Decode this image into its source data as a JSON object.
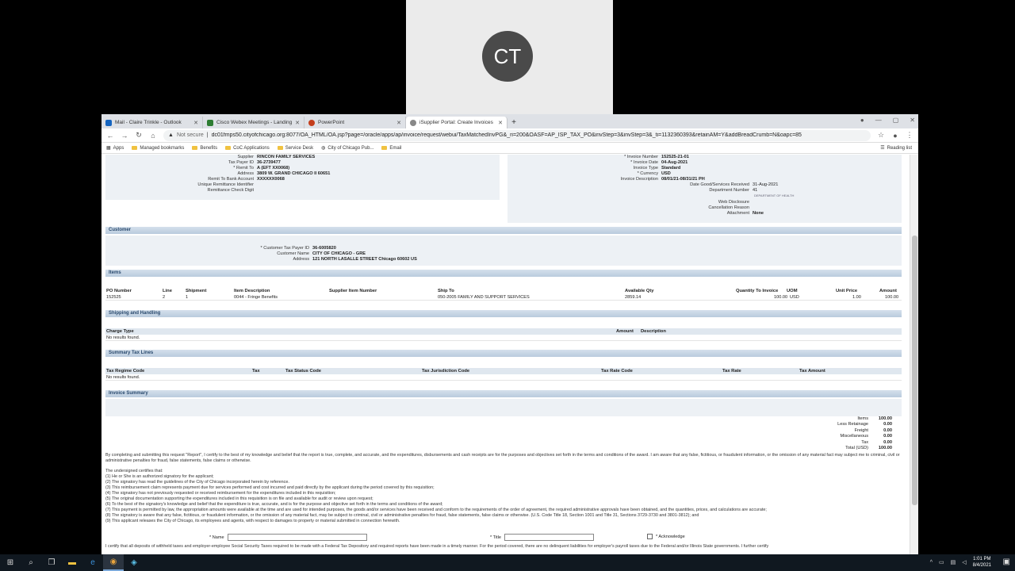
{
  "webex": {
    "initials": "CT"
  },
  "tabs": [
    {
      "label": "Mail - Claire Trinkle - Outlook",
      "color": "#1565c0"
    },
    {
      "label": "Cisco Webex Meetings - Landing",
      "color": "#2e7d32"
    },
    {
      "label": "PowerPoint",
      "color": "#c43e1c"
    },
    {
      "label": "iSupplier Portal: Create Invoices",
      "color": "#555555"
    }
  ],
  "address": {
    "security": "Not secure",
    "url": "dc01fmps50.cityofchicago.org:8077/OA_HTML/OA.jsp?page=/oracle/apps/ap/invoice/request/webui/TaxMatchedInvPG&_ri=200&OASF=AP_ISP_TAX_PO&invStep=3&invStep=3&_ti=1132360393&retainAM=Y&addBreadCrumb=N&oapc=85"
  },
  "bookmarks": [
    "Apps",
    "Managed bookmarks",
    "Benefits",
    "CoC Applications",
    "Service Desk",
    "City of Chicago Pub...",
    "Email"
  ],
  "reading_list": "Reading list",
  "supplier": {
    "rows": [
      {
        "k": "Supplier",
        "v": "RINCON FAMILY SERVICES"
      },
      {
        "k": "Tax Payer ID",
        "v": "36-2739477"
      },
      {
        "k": "* Remit To",
        "v": "A (EFT XX0068)"
      },
      {
        "k": "Address",
        "v": "3809 W. GRAND CHICAGO Il 60651"
      },
      {
        "k": "Remit To Bank Account",
        "v": "XXXXXX0068"
      },
      {
        "k": "Unique Remittance Identifier",
        "v": ""
      },
      {
        "k": "Remittance Check Digit",
        "v": ""
      }
    ]
  },
  "invoice": {
    "rows": [
      {
        "k": "* Invoice Number",
        "v": "152525-21-01"
      },
      {
        "k": "* Invoice Date",
        "v": "04-Aug-2021"
      },
      {
        "k": "Invoice Type",
        "v": "Standard"
      },
      {
        "k": "* Currency",
        "v": "USD"
      },
      {
        "k": "Invoice Description",
        "v": "08/01/21-08/31/21 PH"
      },
      {
        "k": "Date Good/Services Received",
        "v": "31-Aug-2021"
      },
      {
        "k": "Department Number",
        "v": "41"
      }
    ],
    "department_name": "DEPARTMENT OF HEALTH",
    "rows2": [
      {
        "k": "Web Disclosure",
        "v": ""
      },
      {
        "k": "Cancellation Reason",
        "v": ""
      },
      {
        "k": "Attachment",
        "v": "None"
      }
    ]
  },
  "customer": {
    "header": "Customer",
    "rows": [
      {
        "k": "* Customer Tax Payer ID",
        "v": "36-6005820"
      },
      {
        "k": "Customer Name",
        "v": "CITY OF CHICAGO - GRE"
      },
      {
        "k": "Address",
        "v": "121 NORTH LASALLE STREET Chicago 60602 US"
      }
    ]
  },
  "items": {
    "header": "Items",
    "columns": [
      "PO Number",
      "Line",
      "Shipment",
      "Item Description",
      "Supplier Item Number",
      "Ship To",
      "Available Qty",
      "Quantity To Invoice",
      "UOM",
      "Unit Price",
      "Amount"
    ],
    "rows": [
      [
        "152525",
        "2",
        "1",
        "0044 - Fringe Benefits",
        "",
        "050-2005 FAMILY AND SUPPORT SERVICES",
        "2859.14",
        "100.00",
        "USD",
        "1.00",
        "100.00"
      ]
    ]
  },
  "shipping": {
    "header": "Shipping and Handling",
    "columns": [
      "Charge Type",
      "Amount",
      "Description"
    ],
    "empty": "No results found."
  },
  "tax_lines": {
    "header": "Summary Tax Lines",
    "columns": [
      "Tax Regime Code",
      "Tax",
      "Tax Status Code",
      "Tax Jurisdiction Code",
      "Tax Rate Code",
      "Tax Rate",
      "Tax Amount"
    ],
    "empty": "No results found."
  },
  "summary": {
    "header": "Invoice Summary",
    "rows": [
      {
        "k": "Items",
        "v": "100.00"
      },
      {
        "k": "Less Retainage",
        "v": "0.00"
      },
      {
        "k": "Freight",
        "v": "0.00"
      },
      {
        "k": "Miscellaneous",
        "v": "0.00"
      },
      {
        "k": "Tax",
        "v": "0.00"
      },
      {
        "k": "Total (USD)",
        "v": "100.00"
      }
    ]
  },
  "certification": {
    "intro": "By completing and submitting this request \"Report\", I certify to the best of my knowledge and belief that the report is true, complete, and accurate, and the expenditures, disbursements and cash receipts are for the purposes and objectives set forth in the terms and conditions of the award. I am aware that any false, fictitious, or fraudulent information, or the omission of any material fact may subject me to criminal, civil or administrative penalties for fraud, false statements, false claims or otherwise.",
    "lead": "The undersigned certifies that:",
    "items": [
      "(1) He or She is an authorized signatory for the applicant;",
      "(2) The signatory has read the guidelines of the City of Chicago incorporated herein by reference.",
      "(3) This reimbursement claim represents payment due for services performed and cost incurred and paid directly by the applicant during the period covered by this requisition;",
      "(4) The signatory has not previously requested or received reimbursement for the expenditures included in this requisition;",
      "(5) The original documentation supporting the expenditures included in this requisition is on file and available for audit or review upon request;",
      "(6) To the best of the signatory's knowledge and belief that the expenditure is true, accurate, and is for the purpose and objective set forth in the terms and conditions of the award;",
      "(7) This payment is permitted by law, the appropriation amounts were available at the time and are used for intended purposes, the goods and/or services have been received and conform to the requirements of the order of agreement, the required administrative approvals have been obtained, and the quantities, prices, and calculations are accurate;",
      "(8) The signatory is aware that any false, fictitious, or fraudulent information, or the omission of any material fact, may be subject to criminal, civil or administrative penalties for fraud, false statements, false claims or otherwise. (U.S. Code Title 18, Section 1001 and Title 31, Sections 3729-3730 and 3801-3812); and",
      "(9) This applicant releases the City of Chicago, its employees and agents, with respect to damages to property or material submitted in connection herewith."
    ],
    "name_label": "* Name",
    "title_label": "* Title",
    "ack_label": "* Acknowledge",
    "footer": "I certify that all deposits of withheld taxes and employer-employee Social Security Taxes required to be made with a Federal Tax Depository and required reports have been made in a timely manner. For the period covered, there are no delinquent liabilities for employer's payroll taxes due to the Federal and/or Illinois State governments. I further certify"
  },
  "taskbar": {
    "time": "1:01 PM",
    "date": "8/4/2021"
  }
}
